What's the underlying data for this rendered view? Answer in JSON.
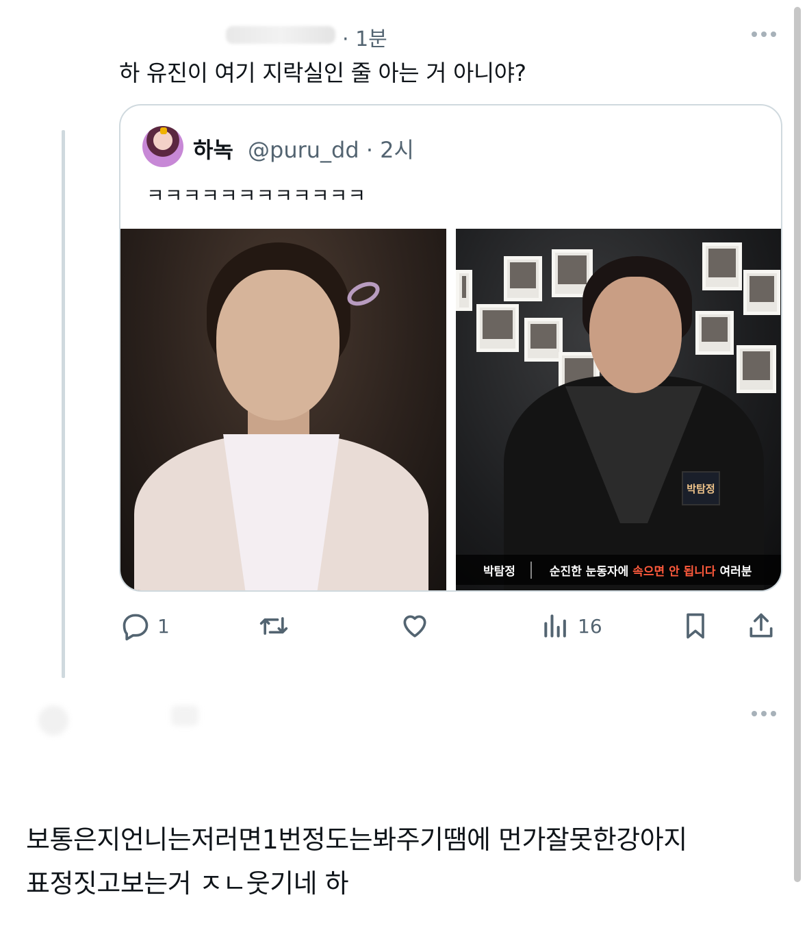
{
  "reply": {
    "time": "· 1분",
    "text": "하 유진이 여기 지락실인 줄 아는 거 아니야?"
  },
  "quote": {
    "name": "하녹",
    "handle": "@puru_dd · 2시",
    "text": "ㅋㅋㅋㅋㅋㅋㅋㅋㅋㅋㅋㅋ",
    "image_right": {
      "name_tag": "박탐정",
      "subtitle_speaker": "박탐정",
      "subtitle_pre": "순진한 눈동자에 ",
      "subtitle_red": "속으면 안 됩니다",
      "subtitle_post": " 여러분"
    }
  },
  "actions": {
    "reply_count": "1",
    "views_count": "16"
  },
  "post": {
    "text": "보통은지언니는저러면1번정도는봐주기땜에 먼가잘못한강아지\n표정짓고보는거 ㅈㄴ웃기네 하"
  },
  "icons": {
    "reply": "reply-bubble-icon",
    "retweet": "retweet-icon",
    "like": "heart-icon",
    "views": "views-bar-chart-icon",
    "bookmark": "bookmark-icon",
    "share": "share-icon",
    "more": "more-dots-icon"
  },
  "colors": {
    "text": "#0f1419",
    "muted": "#536471",
    "border": "#cfd9de",
    "subtitle_highlight": "#ff5a3c"
  }
}
